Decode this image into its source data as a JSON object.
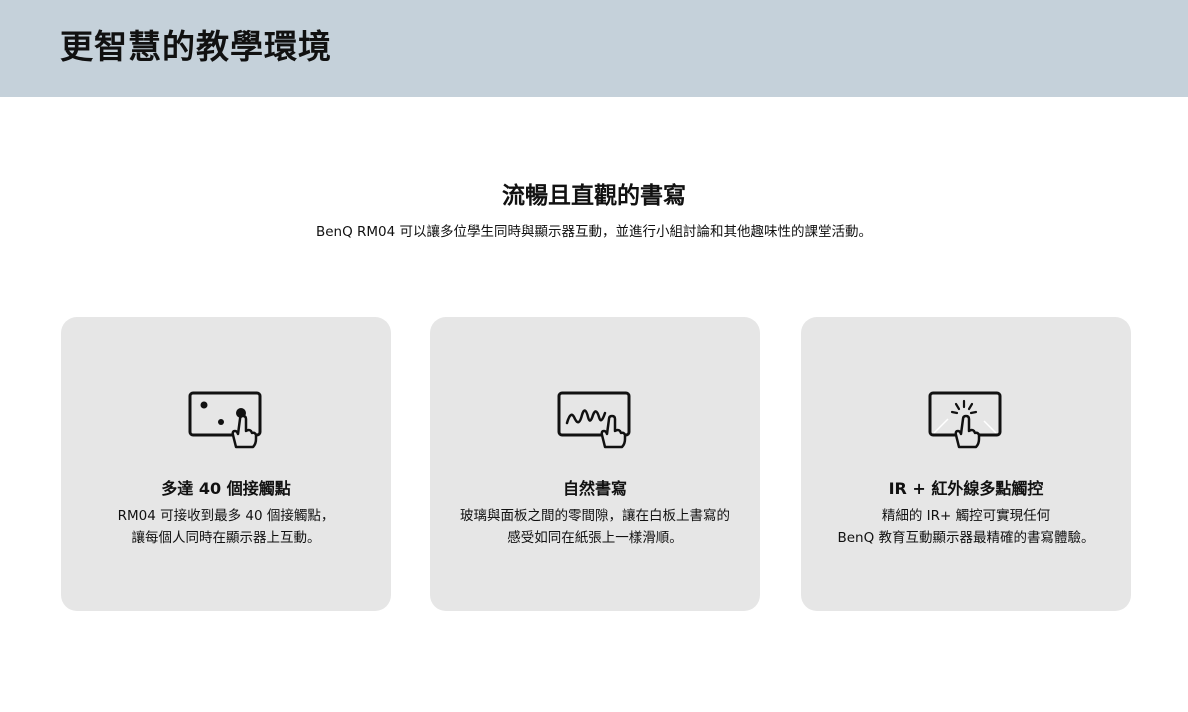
{
  "banner": {
    "title": "更智慧的教學環境"
  },
  "section": {
    "title": "流暢且直觀的書寫",
    "subtitle": "BenQ RM04 可以讓多位學生同時與顯示器互動，並進行小組討論和其他趣味性的課堂活動。"
  },
  "cards": [
    {
      "icon": "multi-touch-points-icon",
      "title": "多達 40 個接觸點",
      "desc_line1": "RM04 可接收到最多 40 個接觸點，",
      "desc_line2": "讓每個人同時在顯示器上互動。"
    },
    {
      "icon": "handwriting-icon",
      "title": "自然書寫",
      "desc_line1": "玻璃與面板之間的零間隙，讓在白板上書寫的",
      "desc_line2": "感受如同在紙張上一樣滑順。"
    },
    {
      "icon": "ir-touch-icon",
      "title": "IR + 紅外線多點觸控",
      "desc_line1": "精細的 IR+ 觸控可實現任何",
      "desc_line2": "BenQ 教育互動顯示器最精確的書寫體驗。"
    }
  ],
  "colors": {
    "banner_bg": "#c5d1da",
    "card_bg": "#e6e6e6",
    "text": "#111111"
  }
}
